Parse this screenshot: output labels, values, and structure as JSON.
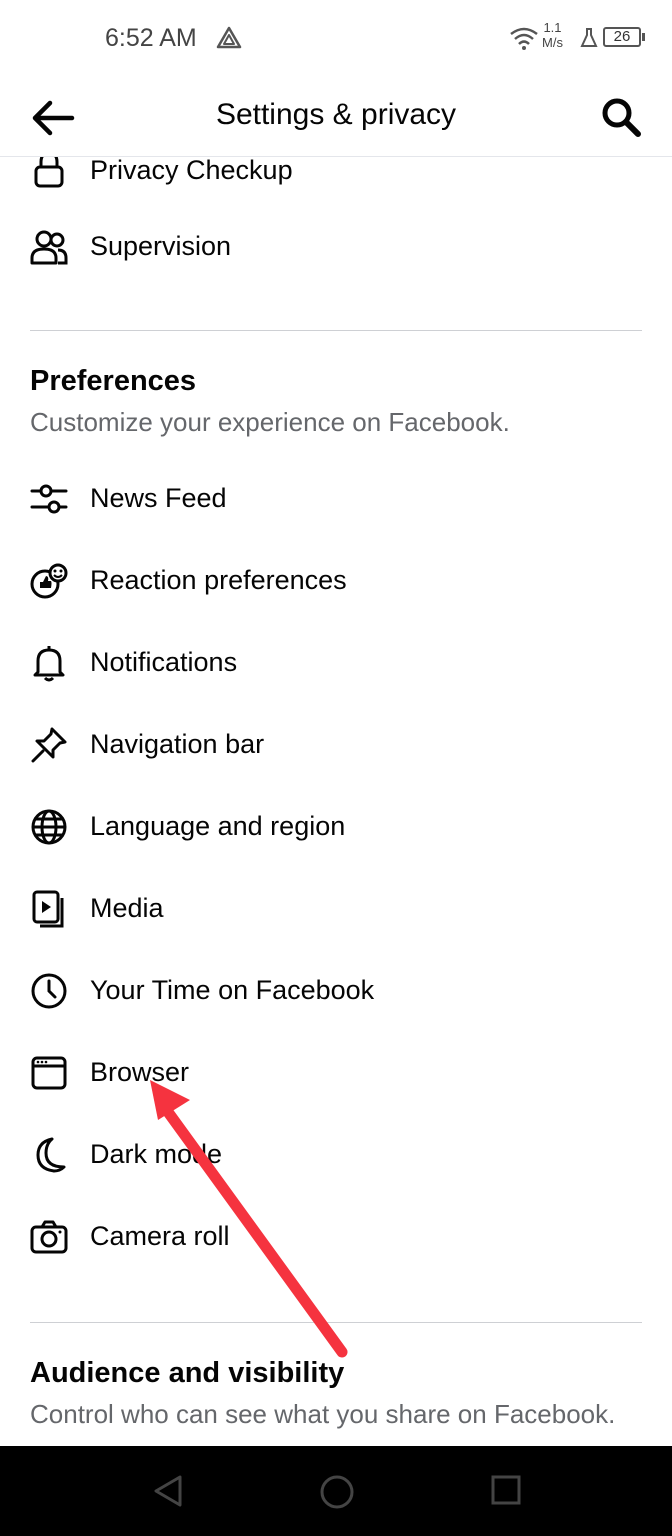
{
  "status_bar": {
    "time": "6:52 AM",
    "speed_top": "1.1",
    "speed_bottom": "M/s",
    "battery": "26"
  },
  "app_bar": {
    "title": "Settings & privacy"
  },
  "top_items": [
    {
      "label": "Privacy Checkup",
      "icon": "lock-icon"
    },
    {
      "label": "Supervision",
      "icon": "people-icon"
    }
  ],
  "preferences": {
    "title": "Preferences",
    "subtitle": "Customize your experience on Facebook.",
    "items": [
      {
        "label": "News Feed",
        "icon": "sliders-icon"
      },
      {
        "label": "Reaction preferences",
        "icon": "reaction-icon"
      },
      {
        "label": "Notifications",
        "icon": "bell-icon"
      },
      {
        "label": "Navigation bar",
        "icon": "pin-icon"
      },
      {
        "label": "Language and region",
        "icon": "globe-icon"
      },
      {
        "label": "Media",
        "icon": "media-icon"
      },
      {
        "label": "Your Time on Facebook",
        "icon": "clock-icon"
      },
      {
        "label": "Browser",
        "icon": "browser-icon"
      },
      {
        "label": "Dark mode",
        "icon": "moon-icon"
      },
      {
        "label": "Camera roll",
        "icon": "camera-icon"
      }
    ]
  },
  "audience": {
    "title": "Audience and visibility",
    "subtitle": "Control who can see what you share on Facebook."
  },
  "colors": {
    "annotation_arrow": "#f5333f",
    "text": "#050505",
    "subtext": "#65676b"
  }
}
